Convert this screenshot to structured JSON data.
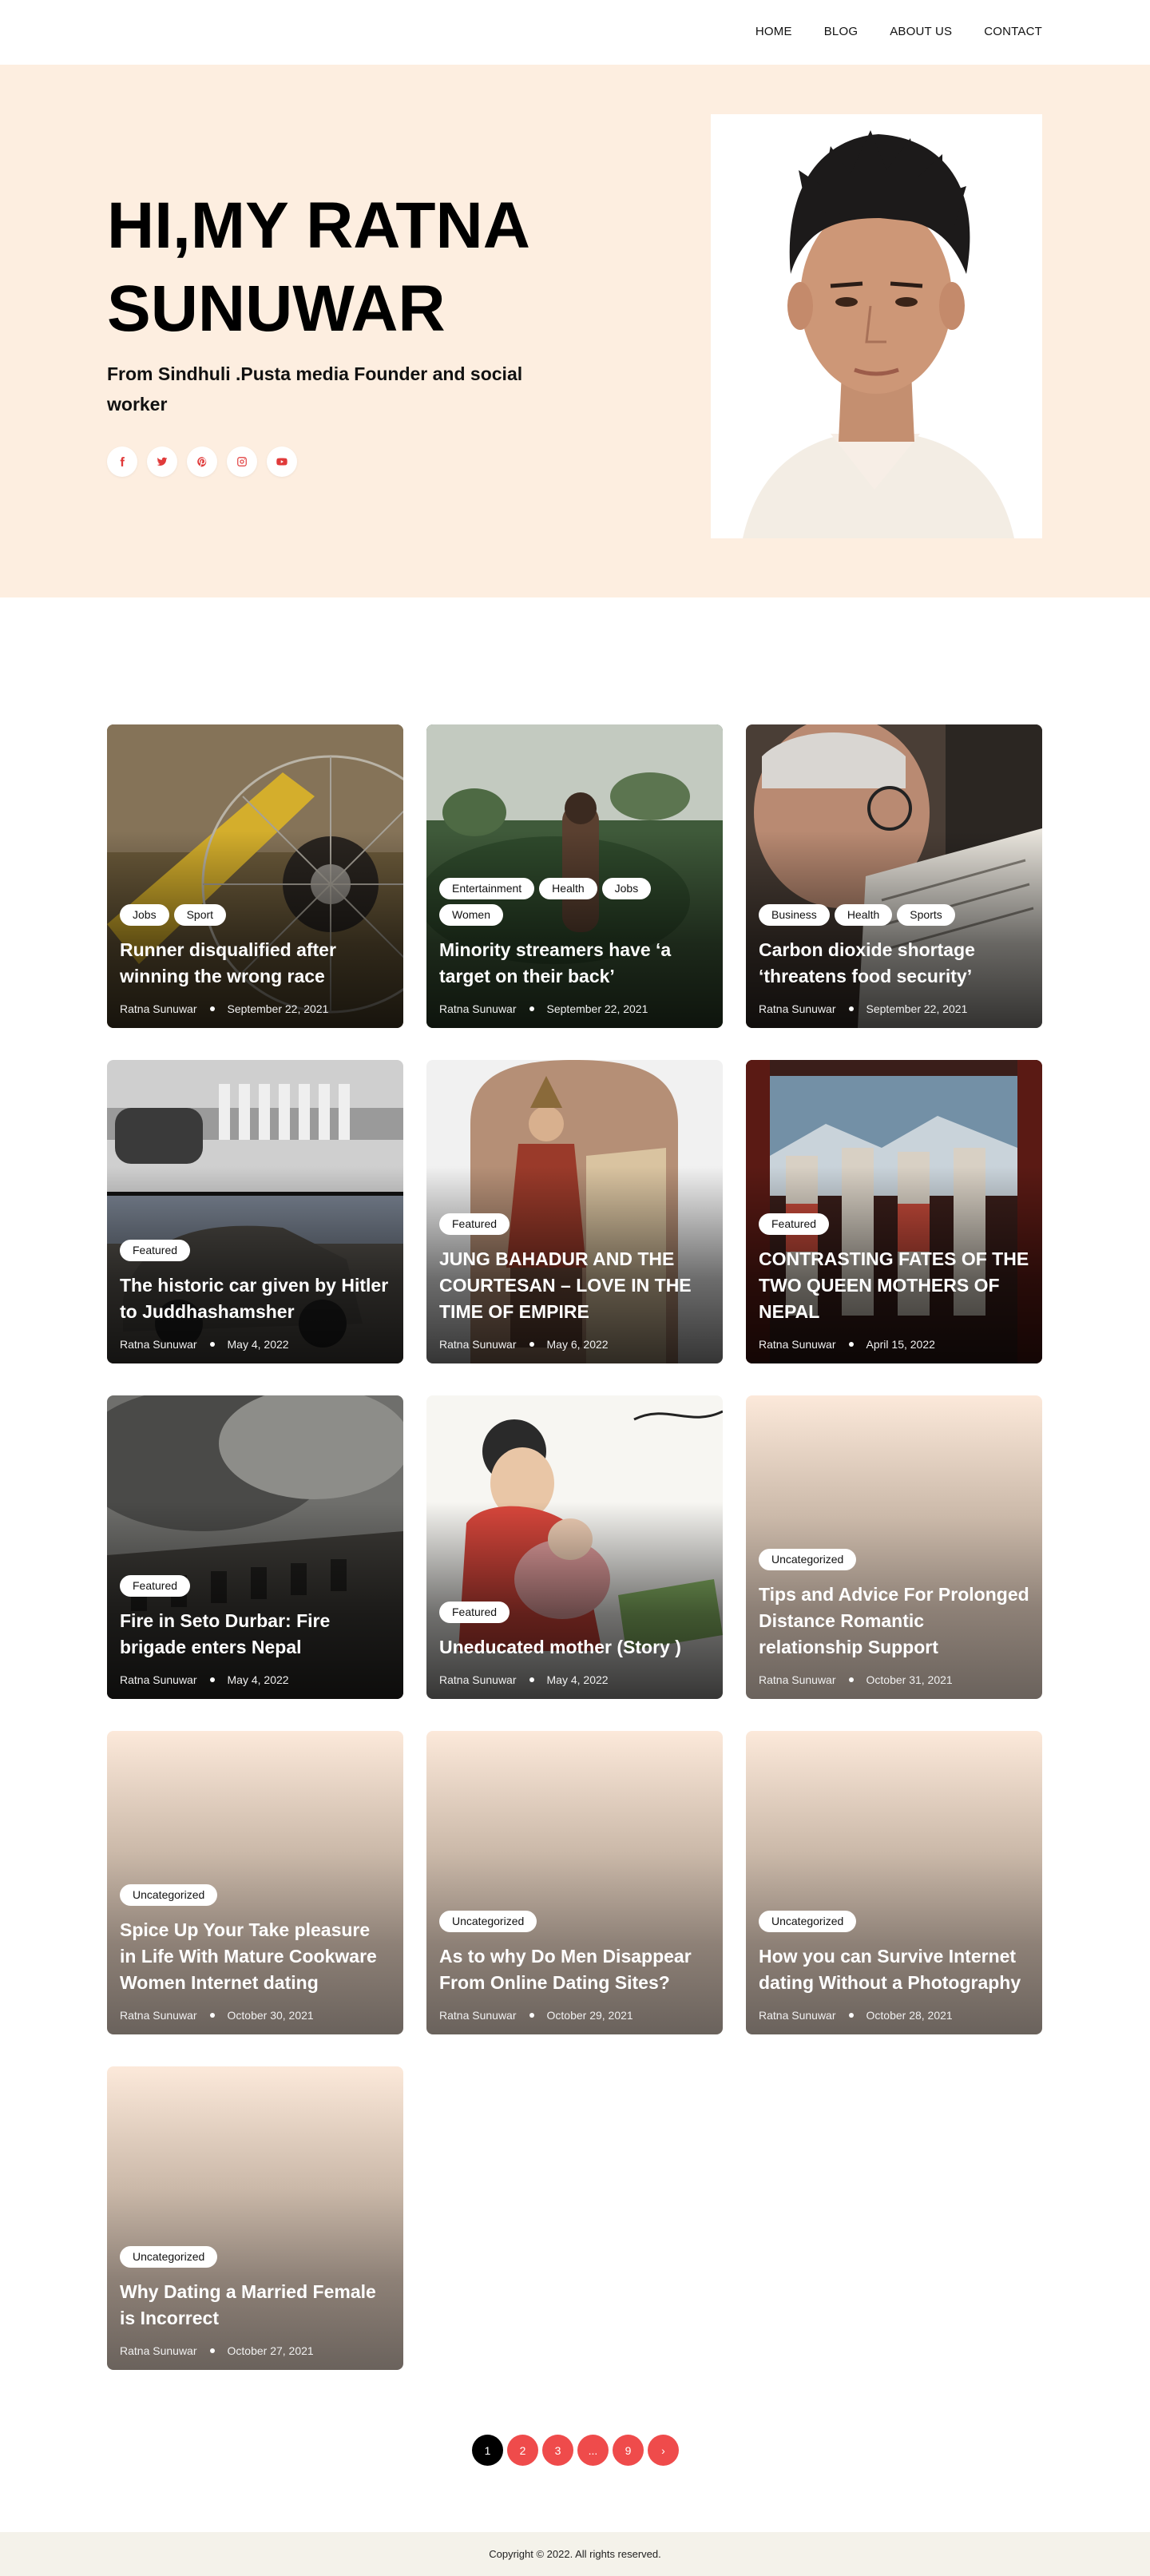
{
  "nav": {
    "items": [
      "HOME",
      "BLOG",
      "ABOUT US",
      "CONTACT"
    ]
  },
  "hero": {
    "title": "HI,MY RATNA SUNUWAR",
    "subtitle": "From Sindhuli .Pusta media Founder and social worker",
    "socials": [
      "facebook-icon",
      "twitter-icon",
      "pinterest-icon",
      "instagram-icon",
      "youtube-icon"
    ]
  },
  "posts": [
    {
      "tags": [
        "Jobs",
        "Sport"
      ],
      "title": "Runner disqualified after winning the wrong race",
      "author": "Ratna Sunuwar",
      "date": "September 22, 2021"
    },
    {
      "tags": [
        "Entertainment",
        "Health",
        "Jobs",
        "Women"
      ],
      "title": "Minority streamers have ‘a target on their back’",
      "author": "Ratna Sunuwar",
      "date": "September 22, 2021"
    },
    {
      "tags": [
        "Business",
        "Health",
        "Sports"
      ],
      "title": "Carbon dioxide shortage ‘threatens food security’",
      "author": "Ratna Sunuwar",
      "date": "September 22, 2021"
    },
    {
      "tags": [
        "Featured"
      ],
      "title": "The historic car given by Hitler to Juddhashamsher",
      "author": "Ratna Sunuwar",
      "date": "May 4, 2022"
    },
    {
      "tags": [
        "Featured"
      ],
      "title": "JUNG BAHADUR AND THE COURTESAN – LOVE IN THE TIME OF EMPIRE",
      "author": "Ratna Sunuwar",
      "date": "May 6, 2022"
    },
    {
      "tags": [
        "Featured"
      ],
      "title": "CONTRASTING FATES OF THE TWO QUEEN MOTHERS OF NEPAL",
      "author": "Ratna Sunuwar",
      "date": "April 15, 2022"
    },
    {
      "tags": [
        "Featured"
      ],
      "title": "Fire in Seto Durbar: Fire brigade enters Nepal",
      "author": "Ratna Sunuwar",
      "date": "May 4, 2022"
    },
    {
      "tags": [
        "Featured"
      ],
      "title": "Uneducated mother (Story )",
      "author": "Ratna Sunuwar",
      "date": "May 4, 2022"
    },
    {
      "tags": [
        "Uncategorized"
      ],
      "title": "Tips and Advice For Prolonged Distance Romantic relationship Support",
      "author": "Ratna Sunuwar",
      "date": "October 31, 2021"
    },
    {
      "tags": [
        "Uncategorized"
      ],
      "title": "Spice Up Your Take pleasure in Life With Mature Cookware Women Internet dating",
      "author": "Ratna Sunuwar",
      "date": "October 30, 2021"
    },
    {
      "tags": [
        "Uncategorized"
      ],
      "title": "As to why Do Men Disappear From Online Dating Sites?",
      "author": "Ratna Sunuwar",
      "date": "October 29, 2021"
    },
    {
      "tags": [
        "Uncategorized"
      ],
      "title": "How you can Survive Internet dating Without a Photography",
      "author": "Ratna Sunuwar",
      "date": "October 28, 2021"
    },
    {
      "tags": [
        "Uncategorized"
      ],
      "title": "Why Dating a Married Female is Incorrect",
      "author": "Ratna Sunuwar",
      "date": "October 27, 2021"
    }
  ],
  "pagination": {
    "pages": [
      "1",
      "2",
      "3",
      "...",
      "9",
      "›"
    ],
    "current": "1"
  },
  "footer": {
    "copyright": "Copyright © 2022. All rights reserved."
  }
}
